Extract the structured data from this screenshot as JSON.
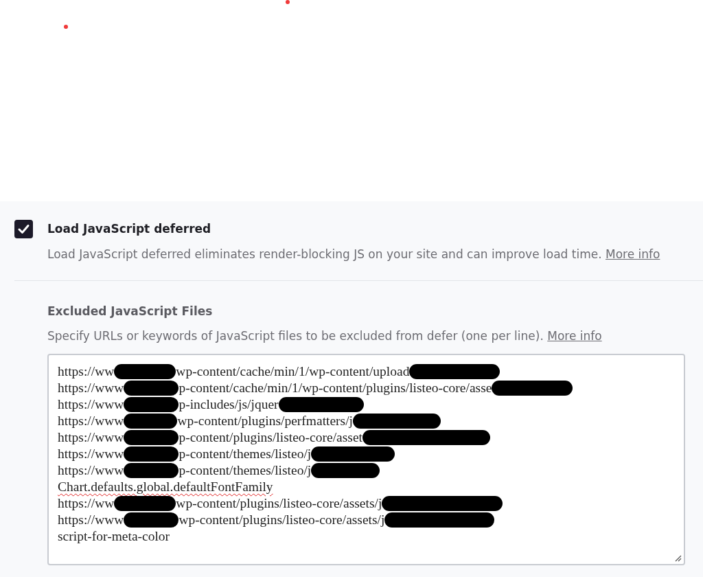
{
  "setting": {
    "checked": true,
    "title": "Load JavaScript deferred",
    "description": "Load JavaScript deferred eliminates render-blocking JS on your site and can improve load time.",
    "link": "More info"
  },
  "excluded_files": {
    "label": "Excluded JavaScript Files",
    "description": "Specify URLs or keywords of JavaScript files to be excluded from defer (one per line).",
    "link": "More info",
    "lines": [
      {
        "parts": [
          {
            "kind": "text",
            "text": "https://ww",
            "misspelled": false
          },
          {
            "kind": "redacted"
          },
          {
            "kind": "text",
            "text": "wp-content/cache/min/1/wp-content/upload",
            "misspelled": false
          },
          {
            "kind": "redacted"
          }
        ]
      },
      {
        "parts": [
          {
            "kind": "text",
            "text": "https://www",
            "misspelled": false
          },
          {
            "kind": "redacted"
          },
          {
            "kind": "text",
            "text": "p-content/cache/min/1/wp-content/plugins/listeo-core/asse",
            "misspelled": false
          },
          {
            "kind": "redacted"
          }
        ]
      },
      {
        "parts": [
          {
            "kind": "text",
            "text": "https://www",
            "misspelled": false
          },
          {
            "kind": "redacted"
          },
          {
            "kind": "text",
            "text": "p-includes/js/jquer",
            "misspelled": false
          },
          {
            "kind": "redacted"
          }
        ]
      },
      {
        "parts": [
          {
            "kind": "text",
            "text": "https://www",
            "misspelled": false
          },
          {
            "kind": "redacted"
          },
          {
            "kind": "text",
            "text": "wp-content/plugins/perfmatters/j",
            "misspelled": false
          },
          {
            "kind": "redacted"
          }
        ]
      },
      {
        "parts": [
          {
            "kind": "text",
            "text": "https://www",
            "misspelled": false
          },
          {
            "kind": "redacted"
          },
          {
            "kind": "text",
            "text": "p-content/plugins/listeo-core/asset",
            "misspelled": false
          },
          {
            "kind": "redacted"
          }
        ]
      },
      {
        "parts": [
          {
            "kind": "text",
            "text": "https://www",
            "misspelled": false
          },
          {
            "kind": "redacted"
          },
          {
            "kind": "text",
            "text": "p-content/themes/listeo/j",
            "misspelled": false
          },
          {
            "kind": "redacted"
          }
        ]
      },
      {
        "parts": [
          {
            "kind": "text",
            "text": "https://www",
            "misspelled": false
          },
          {
            "kind": "redacted"
          },
          {
            "kind": "text",
            "text": "p-content/themes/listeo/j",
            "misspelled": false
          },
          {
            "kind": "redacted"
          }
        ]
      },
      {
        "parts": [
          {
            "kind": "text",
            "text": "Chart.defaults.global.defaultFontFamily",
            "misspelled": true
          }
        ]
      },
      {
        "parts": [
          {
            "kind": "text",
            "text": "https://ww",
            "misspelled": false
          },
          {
            "kind": "redacted"
          },
          {
            "kind": "text",
            "text": "wp-content/plugins/listeo-core/assets/j",
            "misspelled": false
          },
          {
            "kind": "redacted"
          }
        ]
      },
      {
        "parts": [
          {
            "kind": "text",
            "text": "https://www",
            "misspelled": false
          },
          {
            "kind": "redacted"
          },
          {
            "kind": "text",
            "text": "wp-content/plugins/listeo-core/assets/j",
            "misspelled": false
          },
          {
            "kind": "redacted"
          }
        ]
      },
      {
        "parts": [
          {
            "kind": "text",
            "text": "script-for-meta-color",
            "misspelled": false
          }
        ]
      }
    ]
  }
}
